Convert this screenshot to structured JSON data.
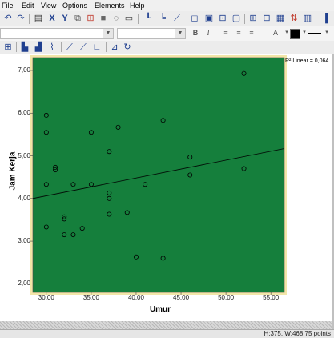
{
  "menu": [
    "File",
    "Edit",
    "View",
    "Options",
    "Elements",
    "Help"
  ],
  "format_bar": {
    "bold": "B",
    "italic": "I"
  },
  "chart_data": {
    "type": "scatter",
    "xlabel": "Umur",
    "ylabel": "Jam Kerja",
    "xlim": [
      28.5,
      56.5
    ],
    "ylim": [
      1.8,
      7.3
    ],
    "x_ticks": [
      "30,00",
      "35,00",
      "40,00",
      "45,00",
      "50,00",
      "55,00"
    ],
    "y_ticks": [
      "2,00",
      "3,00",
      "4,00",
      "5,00",
      "6,00",
      "7,00"
    ],
    "points": [
      {
        "x": 30,
        "y": 5.95
      },
      {
        "x": 30,
        "y": 5.55
      },
      {
        "x": 30,
        "y": 4.33
      },
      {
        "x": 30,
        "y": 3.33
      },
      {
        "x": 31,
        "y": 4.73
      },
      {
        "x": 31,
        "y": 4.67
      },
      {
        "x": 32,
        "y": 3.57
      },
      {
        "x": 32,
        "y": 3.52
      },
      {
        "x": 32,
        "y": 3.15
      },
      {
        "x": 33,
        "y": 4.33
      },
      {
        "x": 33,
        "y": 3.15
      },
      {
        "x": 34,
        "y": 3.3
      },
      {
        "x": 35,
        "y": 5.55
      },
      {
        "x": 35,
        "y": 4.33
      },
      {
        "x": 37,
        "y": 5.1
      },
      {
        "x": 37,
        "y": 4.13
      },
      {
        "x": 37,
        "y": 4.0
      },
      {
        "x": 37,
        "y": 3.63
      },
      {
        "x": 38,
        "y": 5.67
      },
      {
        "x": 39,
        "y": 3.67
      },
      {
        "x": 40,
        "y": 2.63
      },
      {
        "x": 41,
        "y": 4.33
      },
      {
        "x": 43,
        "y": 5.83
      },
      {
        "x": 43,
        "y": 2.6
      },
      {
        "x": 46,
        "y": 4.97
      },
      {
        "x": 46,
        "y": 4.55
      },
      {
        "x": 52,
        "y": 6.93
      },
      {
        "x": 52,
        "y": 4.7
      }
    ],
    "fit_line": {
      "x": [
        28.5,
        56.5
      ],
      "y": [
        4.0,
        5.17
      ]
    },
    "fit_label": "R² Linear = 0,064",
    "plot_bg": "#157f3c",
    "frame_color": "#f2e6a8",
    "marker_color": "#000000",
    "grid": false
  },
  "status": "H:375, W:468,75 points"
}
